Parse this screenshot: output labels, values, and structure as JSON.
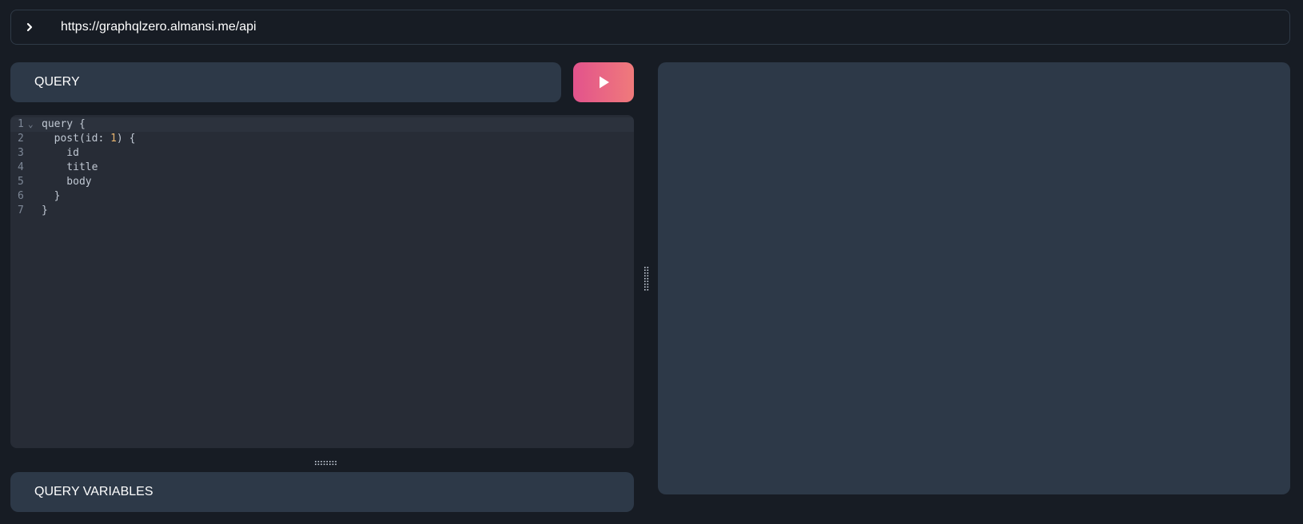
{
  "url_bar": {
    "toggle_icon": "chevron-right-icon",
    "url": "https://graphqlzero.almansi.me/api"
  },
  "query_panel": {
    "title": "QUERY",
    "run_icon": "play-icon",
    "run_gradient": [
      "#e2538c",
      "#f07a7b"
    ]
  },
  "editor": {
    "lines": [
      {
        "n": "1",
        "fold": "⌄",
        "text": "query {"
      },
      {
        "n": "2",
        "fold": "",
        "text": "  post(id: 1) {"
      },
      {
        "n": "3",
        "fold": "",
        "text": "    id"
      },
      {
        "n": "4",
        "fold": "",
        "text": "    title"
      },
      {
        "n": "5",
        "fold": "",
        "text": "    body"
      },
      {
        "n": "6",
        "fold": "",
        "text": "  }"
      },
      {
        "n": "7",
        "fold": "",
        "text": "}"
      }
    ]
  },
  "variables_panel": {
    "title": "QUERY VARIABLES"
  },
  "colors": {
    "background": "#171c24",
    "panel": "#2d3948",
    "editor_bg": "#272c36",
    "number_token": "#e8b570"
  }
}
